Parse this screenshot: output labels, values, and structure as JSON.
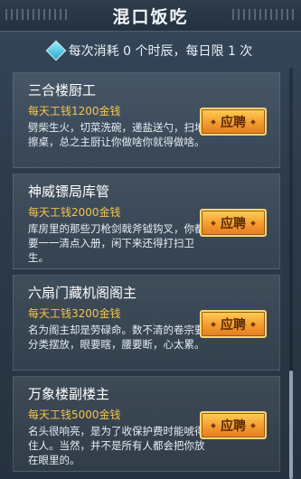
{
  "window": {
    "title": "混口饭吃"
  },
  "quota": {
    "text": "每次消耗 0 个时辰，每日限 1 次",
    "icon": "gem-icon"
  },
  "jobs": [
    {
      "name": "三合楼厨工",
      "wage": "每天工钱1200金钱",
      "desc": "劈柴生火，切菜洗碗，递盐送勺，扫地擦桌，总之主厨让你做啥你就得做啥。",
      "button": "应聘"
    },
    {
      "name": "神威镖局库管",
      "wage": "每天工钱2000金钱",
      "desc": "库房里的那些刀枪剑戟斧钺钩叉，你都要一一清点入册，闲下来还得打扫卫生。",
      "button": "应聘"
    },
    {
      "name": "六扇门藏机阁阁主",
      "wage": "每天工钱3200金钱",
      "desc": "名为阁主却是劳碌命。数不清的卷宗要分类摆放，眼要瞎，腰要断，心太累。",
      "button": "应聘"
    },
    {
      "name": "万象楼副楼主",
      "wage": "每天工钱5000金钱",
      "desc": "名头很响亮，是为了收保护费时能唬得住人。当然，并不是所有人都会把你放在眼里的。",
      "button": "应聘"
    }
  ],
  "colors": {
    "wage": "#f3c54b",
    "button": "#f39b2e",
    "panel": "#2c3b4b"
  }
}
